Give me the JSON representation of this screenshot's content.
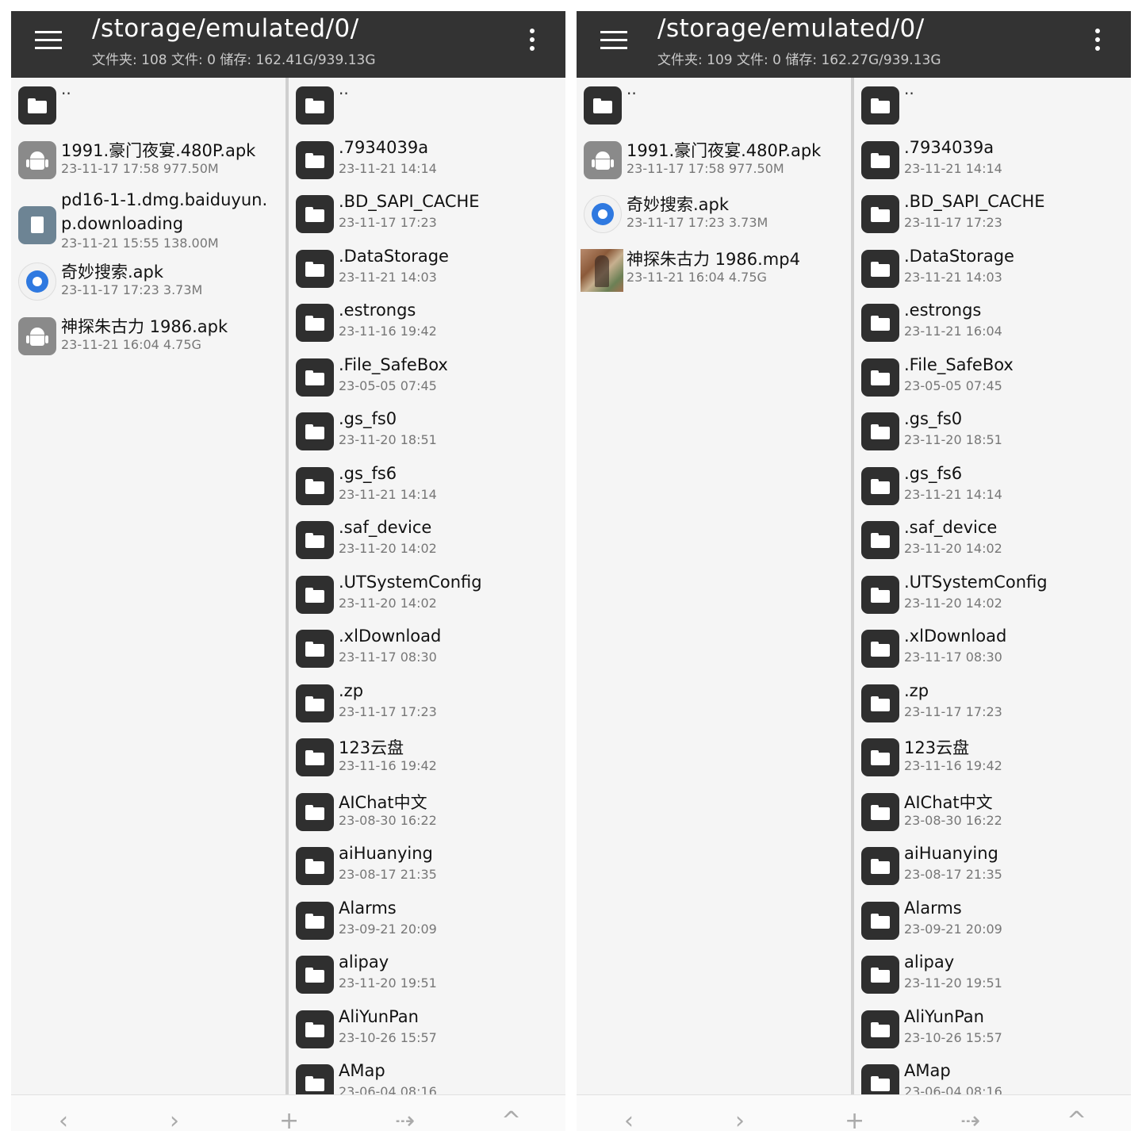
{
  "screens": [
    {
      "header": {
        "title": "/storage/emulated/0/",
        "subtitle": "文件夹: 108   文件: 0   储存: 162.41G/939.13G"
      },
      "left_pane": [
        {
          "type": "folder",
          "name": "..",
          "meta": ""
        },
        {
          "type": "apk",
          "name": "1991.豪门夜宴.480P.apk",
          "meta": "23-11-17  17:58   977.50M"
        },
        {
          "type": "doc",
          "name": "pd16-1-1.dmg.baiduyun.p.downloading",
          "meta": "23-11-21  15:55   138.00M"
        },
        {
          "type": "app",
          "name": "奇妙搜索.apk",
          "meta": "23-11-17  17:23   3.73M"
        },
        {
          "type": "apk",
          "name": "神探朱古力 1986.apk",
          "meta": "23-11-21  16:04   4.75G"
        }
      ],
      "right_pane": [
        {
          "name": "..",
          "meta": ""
        },
        {
          "name": ".7934039a",
          "meta": "23-11-21  14:14"
        },
        {
          "name": ".BD_SAPI_CACHE",
          "meta": "23-11-17  17:23"
        },
        {
          "name": ".DataStorage",
          "meta": "23-11-21  14:03"
        },
        {
          "name": ".estrongs",
          "meta": "23-11-16  19:42"
        },
        {
          "name": ".File_SafeBox",
          "meta": "23-05-05  07:45"
        },
        {
          "name": ".gs_fs0",
          "meta": "23-11-20  18:51"
        },
        {
          "name": ".gs_fs6",
          "meta": "23-11-21  14:14"
        },
        {
          "name": ".saf_device",
          "meta": "23-11-20  14:02"
        },
        {
          "name": ".UTSystemConfig",
          "meta": "23-11-20  14:02"
        },
        {
          "name": ".xlDownload",
          "meta": "23-11-17  08:30"
        },
        {
          "name": ".zp",
          "meta": "23-11-17  17:23"
        },
        {
          "name": "123云盘",
          "meta": "23-11-16  19:42"
        },
        {
          "name": "AIChat中文",
          "meta": "23-08-30  16:22"
        },
        {
          "name": "aiHuanying",
          "meta": "23-08-17  21:35"
        },
        {
          "name": "Alarms",
          "meta": "23-09-21  20:09"
        },
        {
          "name": "alipay",
          "meta": "23-11-20  19:51"
        },
        {
          "name": "AliYunPan",
          "meta": "23-10-26  15:57"
        },
        {
          "name": "AMap",
          "meta": "23-06-04  08:16"
        }
      ]
    },
    {
      "header": {
        "title": "/storage/emulated/0/",
        "subtitle": "文件夹: 109   文件: 0   储存: 162.27G/939.13G"
      },
      "left_pane": [
        {
          "type": "folder",
          "name": "..",
          "meta": ""
        },
        {
          "type": "apk",
          "name": "1991.豪门夜宴.480P.apk",
          "meta": "23-11-17  17:58   977.50M"
        },
        {
          "type": "app",
          "name": "奇妙搜索.apk",
          "meta": "23-11-17  17:23   3.73M"
        },
        {
          "type": "video",
          "name": "神探朱古力 1986.mp4",
          "meta": "23-11-21  16:04   4.75G"
        }
      ],
      "right_pane": [
        {
          "name": "..",
          "meta": ""
        },
        {
          "name": ".7934039a",
          "meta": "23-11-21  14:14"
        },
        {
          "name": ".BD_SAPI_CACHE",
          "meta": "23-11-17  17:23"
        },
        {
          "name": ".DataStorage",
          "meta": "23-11-21  14:03"
        },
        {
          "name": ".estrongs",
          "meta": "23-11-21  16:04"
        },
        {
          "name": ".File_SafeBox",
          "meta": "23-05-05  07:45"
        },
        {
          "name": ".gs_fs0",
          "meta": "23-11-20  18:51"
        },
        {
          "name": ".gs_fs6",
          "meta": "23-11-21  14:14"
        },
        {
          "name": ".saf_device",
          "meta": "23-11-20  14:02"
        },
        {
          "name": ".UTSystemConfig",
          "meta": "23-11-20  14:02"
        },
        {
          "name": ".xlDownload",
          "meta": "23-11-17  08:30"
        },
        {
          "name": ".zp",
          "meta": "23-11-17  17:23"
        },
        {
          "name": "123云盘",
          "meta": "23-11-16  19:42"
        },
        {
          "name": "AIChat中文",
          "meta": "23-08-30  16:22"
        },
        {
          "name": "aiHuanying",
          "meta": "23-08-17  21:35"
        },
        {
          "name": "Alarms",
          "meta": "23-09-21  20:09"
        },
        {
          "name": "alipay",
          "meta": "23-11-20  19:51"
        },
        {
          "name": "AliYunPan",
          "meta": "23-10-26  15:57"
        },
        {
          "name": "AMap",
          "meta": "23-06-04  08:16"
        }
      ]
    }
  ],
  "bottom_bar": {
    "back": "‹",
    "forward": "›",
    "add": "+",
    "transfer": "⇢",
    "up": "^"
  },
  "colors": {
    "toolbar": "#333333",
    "folder_icon": "#2f2f2f",
    "apk_icon": "#8a8a8a",
    "app_icon_accent": "#2f79e0",
    "background": "#f5f5f5"
  }
}
